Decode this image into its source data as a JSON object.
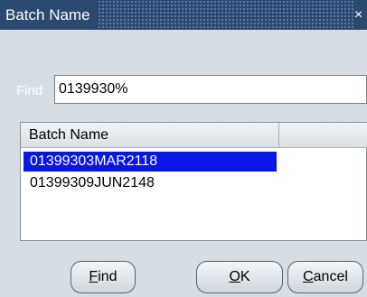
{
  "dialog": {
    "title": "Batch Name",
    "close_glyph": "×"
  },
  "find": {
    "label": "Find",
    "value": "0139930%"
  },
  "list": {
    "header": "Batch Name",
    "rows": [
      {
        "label": "01399303MAR2118",
        "selected": true
      },
      {
        "label": "01399309JUN2148",
        "selected": false
      }
    ]
  },
  "buttons": {
    "find": {
      "mnemonic": "F",
      "rest": "ind"
    },
    "ok": {
      "mnemonic": "O",
      "rest": "K"
    },
    "cancel": {
      "mnemonic": "C",
      "rest": "ancel"
    }
  },
  "colors": {
    "titlebar": "#2a4a72",
    "background": "#d6dee4",
    "selection": "#0a16e6"
  }
}
